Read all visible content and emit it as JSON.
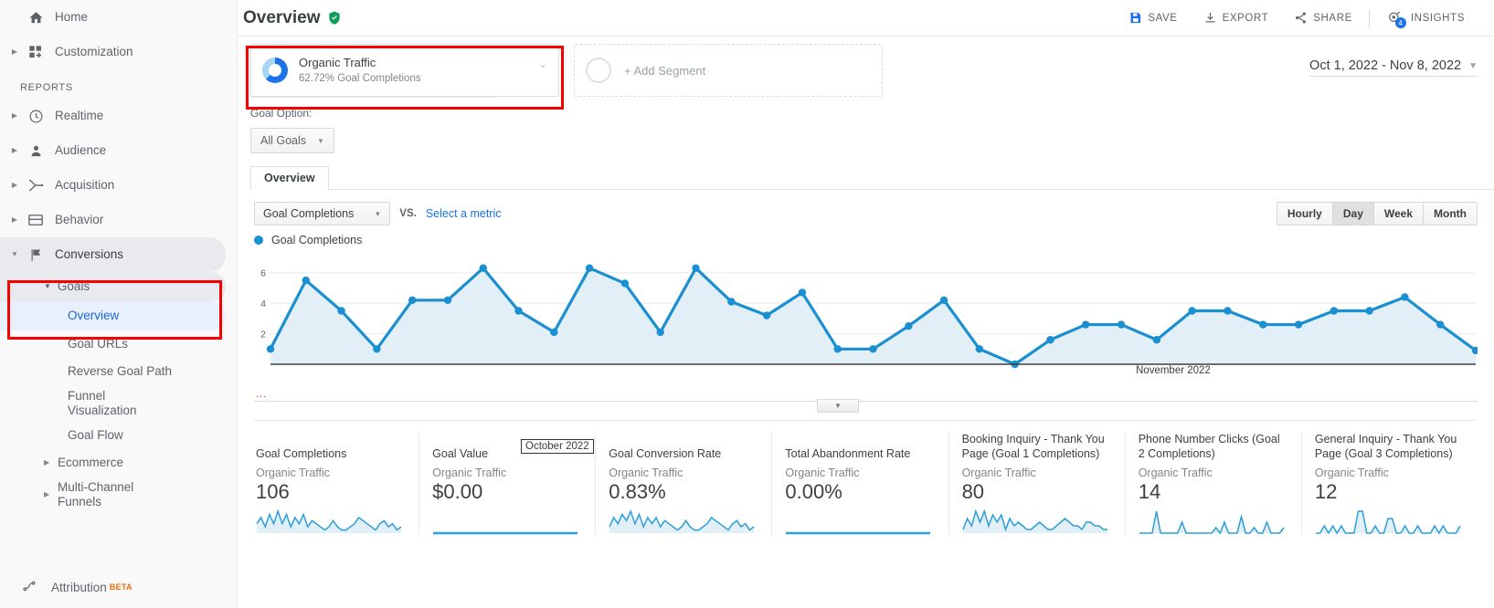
{
  "sidebar": {
    "home": {
      "label": "Home",
      "icon": "home-icon"
    },
    "customization": {
      "label": "Customization",
      "icon": "customization-icon"
    },
    "section_label": "REPORTS",
    "items": [
      {
        "label": "Realtime",
        "icon": "clock-icon"
      },
      {
        "label": "Audience",
        "icon": "person-icon"
      },
      {
        "label": "Acquisition",
        "icon": "acquisition-icon"
      },
      {
        "label": "Behavior",
        "icon": "behavior-icon"
      },
      {
        "label": "Conversions",
        "icon": "flag-icon"
      }
    ],
    "goals": {
      "label": "Goals"
    },
    "goal_children": [
      {
        "label": "Overview"
      },
      {
        "label": "Goal URLs"
      },
      {
        "label": "Reverse Goal Path"
      },
      {
        "label": "Funnel Visualization"
      },
      {
        "label": "Goal Flow"
      }
    ],
    "ecommerce": {
      "label": "Ecommerce"
    },
    "multichannel": {
      "label": "Multi-Channel Funnels"
    },
    "attribution": {
      "label": "Attribution",
      "badge": "BETA"
    }
  },
  "header": {
    "title": "Overview",
    "shield_icon": "verified-shield-icon",
    "actions": [
      {
        "label": "SAVE",
        "icon": "save-icon"
      },
      {
        "label": "EXPORT",
        "icon": "export-icon"
      },
      {
        "label": "SHARE",
        "icon": "share-icon"
      },
      {
        "label": "INSIGHTS",
        "icon": "insights-icon",
        "badge": "4"
      }
    ]
  },
  "segments": {
    "selected": {
      "name": "Organic Traffic",
      "sub": "62.72% Goal Completions",
      "percent": 62.72
    },
    "add_label": "+ Add Segment"
  },
  "date_range": {
    "value": "Oct 1, 2022 - Nov 8, 2022"
  },
  "goal_option": {
    "label": "Goal Option:",
    "selected": "All Goals"
  },
  "tabs": [
    {
      "label": "Overview",
      "active": true
    }
  ],
  "chart_controls": {
    "metric_selected": "Goal Completions",
    "vs_label": "VS.",
    "select_metric_link": "Select a metric",
    "granularity": [
      {
        "label": "Hourly",
        "selected": false
      },
      {
        "label": "Day",
        "selected": true
      },
      {
        "label": "Week",
        "selected": false
      },
      {
        "label": "Month",
        "selected": false
      }
    ]
  },
  "chart_data": {
    "type": "line",
    "title": "",
    "legend": [
      "Goal Completions"
    ],
    "legend_position": "top-left",
    "series": [
      {
        "name": "Goal Completions",
        "values": [
          1,
          5.5,
          3.5,
          1,
          4.2,
          4.2,
          6.3,
          3.5,
          2.1,
          6.3,
          5.3,
          2.1,
          6.3,
          4.1,
          3.2,
          4.7,
          1,
          1,
          2.5,
          4.2,
          1,
          0,
          1.6,
          2.6,
          2.6,
          1.6,
          3.5,
          3.5,
          2.6,
          2.6,
          3.5,
          3.5,
          4.4,
          2.6,
          0.9
        ]
      }
    ],
    "ylim": [
      0,
      7
    ],
    "yticks": [
      2,
      4,
      6
    ],
    "ylabel": "",
    "xlabel": "",
    "grid": true,
    "axis_labels": [
      "October 2022",
      "November 2022"
    ],
    "color": "#1a8fd1",
    "fill": "#e3eff7"
  },
  "cards": [
    {
      "title": "Goal Completions",
      "segment": "Organic Traffic",
      "value": "106",
      "spark": [
        3,
        5,
        2,
        6,
        3,
        7,
        3,
        6,
        2,
        5,
        3,
        6,
        2,
        4,
        3,
        2,
        1,
        2,
        4,
        2,
        1,
        1,
        2,
        3,
        5,
        4,
        3,
        2,
        1,
        3,
        4,
        2,
        3,
        1,
        2
      ]
    },
    {
      "title": "Goal Value",
      "segment": "Organic Traffic",
      "value": "$0.00",
      "spark": [
        0,
        0,
        0,
        0,
        0,
        0,
        0,
        0,
        0,
        0,
        0,
        0,
        0,
        0,
        0,
        0,
        0,
        0,
        0,
        0,
        0,
        0,
        0,
        0,
        0,
        0,
        0,
        0,
        0,
        0,
        0,
        0,
        0,
        0,
        0
      ]
    },
    {
      "title": "Goal Conversion Rate",
      "segment": "Organic Traffic",
      "value": "0.83%",
      "spark": [
        2,
        5,
        3,
        6,
        4,
        7,
        3,
        6,
        2,
        5,
        3,
        5,
        2,
        4,
        3,
        2,
        1,
        2,
        4,
        2,
        1,
        1,
        2,
        3,
        5,
        4,
        3,
        2,
        1,
        3,
        4,
        2,
        3,
        1,
        2
      ]
    },
    {
      "title": "Total Abandonment Rate",
      "segment": "Organic Traffic",
      "value": "0.00%",
      "spark": [
        0,
        0,
        0,
        0,
        0,
        0,
        0,
        0,
        0,
        0,
        0,
        0,
        0,
        0,
        0,
        0,
        0,
        0,
        0,
        0,
        0,
        0,
        0,
        0,
        0,
        0,
        0,
        0,
        0,
        0,
        0,
        0,
        0,
        0,
        0
      ]
    },
    {
      "title": "Booking Inquiry - Thank You Page (Goal 1 Completions)",
      "segment": "Organic Traffic",
      "value": "80",
      "spark": [
        1,
        4,
        2,
        6,
        3,
        6,
        2,
        5,
        3,
        5,
        1,
        4,
        2,
        3,
        2,
        1,
        1,
        2,
        3,
        2,
        1,
        1,
        2,
        3,
        4,
        3,
        2,
        2,
        1,
        3,
        3,
        2,
        2,
        1,
        1
      ]
    },
    {
      "title": "Phone Number Clicks (Goal 2 Completions)",
      "segment": "Organic Traffic",
      "value": "14",
      "spark": [
        0,
        0,
        0,
        0,
        4,
        0,
        0,
        0,
        0,
        0,
        2,
        0,
        0,
        0,
        0,
        0,
        0,
        0,
        1,
        0,
        2,
        0,
        0,
        0,
        3,
        0,
        0,
        1,
        0,
        0,
        2,
        0,
        0,
        0,
        1
      ]
    },
    {
      "title": "General Inquiry - Thank You Page (Goal 3 Completions)",
      "segment": "Organic Traffic",
      "value": "12",
      "spark": [
        0,
        0,
        1,
        0,
        1,
        0,
        1,
        0,
        0,
        0,
        3,
        3,
        0,
        0,
        1,
        0,
        0,
        2,
        2,
        0,
        0,
        1,
        0,
        0,
        1,
        0,
        0,
        0,
        1,
        0,
        1,
        0,
        0,
        0,
        1
      ]
    }
  ]
}
